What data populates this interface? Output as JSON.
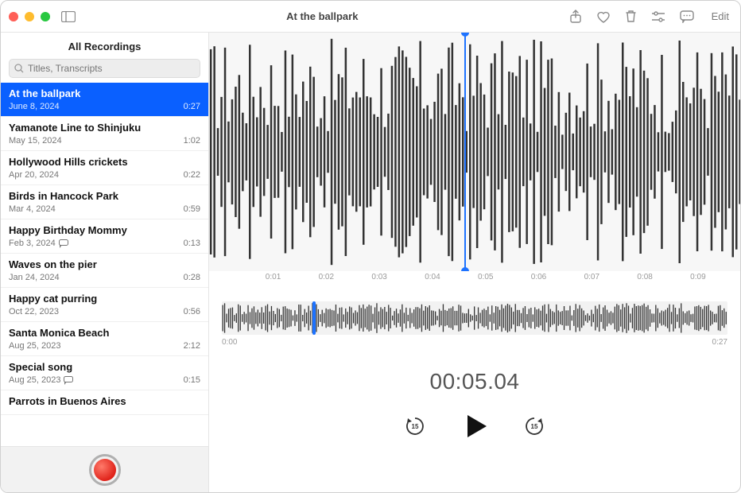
{
  "window": {
    "title": "At the ballpark"
  },
  "colors": {
    "accent": "#0a60ff",
    "playhead": "#1d72ff",
    "record": "#e0231a"
  },
  "toolbar": {
    "sidebar_toggle": "sidebar-toggle",
    "share": "share-icon",
    "favorite": "heart-icon",
    "trash": "trash-icon",
    "settings": "sliders-icon",
    "transcript": "speech-bubble-icon",
    "edit_label": "Edit"
  },
  "sidebar": {
    "header": "All Recordings",
    "search_placeholder": "Titles, Transcripts",
    "items": [
      {
        "title": "At the ballpark",
        "date": "June 8, 2024",
        "duration": "0:27",
        "selected": true,
        "has_transcript": false
      },
      {
        "title": "Yamanote Line to Shinjuku",
        "date": "May 15, 2024",
        "duration": "1:02",
        "selected": false,
        "has_transcript": false
      },
      {
        "title": "Hollywood Hills crickets",
        "date": "Apr 20, 2024",
        "duration": "0:22",
        "selected": false,
        "has_transcript": false
      },
      {
        "title": "Birds in Hancock Park",
        "date": "Mar 4, 2024",
        "duration": "0:59",
        "selected": false,
        "has_transcript": false
      },
      {
        "title": "Happy Birthday Mommy",
        "date": "Feb 3, 2024",
        "duration": "0:13",
        "selected": false,
        "has_transcript": true
      },
      {
        "title": "Waves on the pier",
        "date": "Jan 24, 2024",
        "duration": "0:28",
        "selected": false,
        "has_transcript": false
      },
      {
        "title": "Happy cat purring",
        "date": "Oct 22, 2023",
        "duration": "0:56",
        "selected": false,
        "has_transcript": false
      },
      {
        "title": "Santa Monica Beach",
        "date": "Aug 25, 2023",
        "duration": "2:12",
        "selected": false,
        "has_transcript": false
      },
      {
        "title": "Special song",
        "date": "Aug 25, 2023",
        "duration": "0:15",
        "selected": false,
        "has_transcript": true
      },
      {
        "title": "Parrots in Buenos Aires",
        "date": "",
        "duration": "",
        "selected": false,
        "has_transcript": false
      }
    ]
  },
  "main": {
    "timeline_ticks": [
      "",
      "0:01",
      "0:02",
      "0:03",
      "0:04",
      "0:05",
      "0:06",
      "0:07",
      "0:08",
      "0:09"
    ],
    "playhead_position_pct": 48,
    "mini_range_start": "0:00",
    "mini_range_end": "0:27",
    "mini_playhead_pct": 18,
    "timecode": "00:05.04"
  },
  "controls": {
    "skip_back_seconds": "15",
    "skip_forward_seconds": "15"
  }
}
